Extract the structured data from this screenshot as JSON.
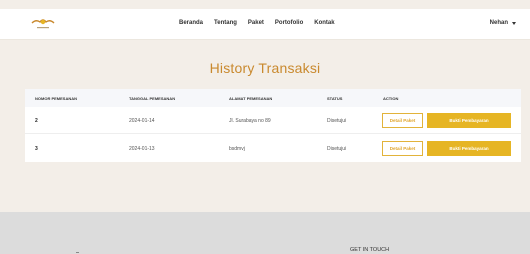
{
  "nav": {
    "logo_icon": "brand-logo-icon",
    "links": [
      "Beranda",
      "Tentang",
      "Paket",
      "Portofolio",
      "Kontak"
    ],
    "user_name": "Nehan"
  },
  "page": {
    "title": "History Transaksi"
  },
  "table": {
    "headers": [
      "NOMOR PEMESANAN",
      "TANGGAL PEMESANAN",
      "ALAMAT PEMESANAN",
      "STATUS",
      "ACTION"
    ],
    "rows": [
      {
        "nomor": "2",
        "tanggal": "2024-01-14",
        "alamat": "Jl. Surabaya no 89",
        "status": "Disetujui",
        "detail_label": "Detail Paket",
        "bukti_label": "Bukti Pembayaran"
      },
      {
        "nomor": "3",
        "tanggal": "2024-01-13",
        "alamat": "bsdmvj",
        "status": "Disetujui",
        "detail_label": "Detail Paket",
        "bukti_label": "Bukti Pembayaran"
      }
    ]
  },
  "footer": {
    "heading": "GET IN TOUCH"
  },
  "colors": {
    "accent": "#e6b524",
    "title": "#c9892e",
    "background": "#f3eee8",
    "footer": "#dcdcdc"
  }
}
